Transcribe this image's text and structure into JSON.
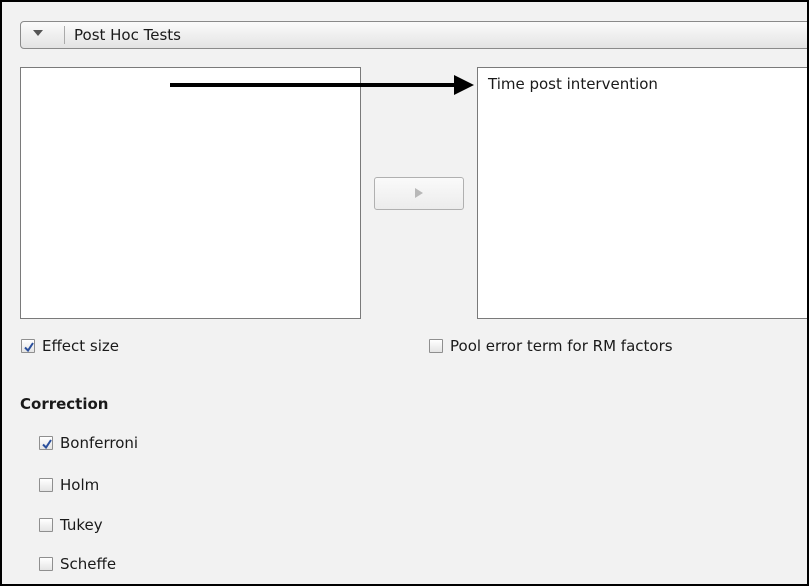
{
  "section": {
    "title": "Post Hoc Tests"
  },
  "lists": {
    "target_items": [
      "Time post intervention"
    ]
  },
  "options": {
    "effect_size": {
      "label": "Effect size",
      "checked": true
    },
    "pool_error": {
      "label": "Pool error term for RM factors",
      "checked": false
    }
  },
  "correction": {
    "heading": "Correction",
    "items": [
      {
        "label": "Bonferroni",
        "checked": true
      },
      {
        "label": "Holm",
        "checked": false
      },
      {
        "label": "Tukey",
        "checked": false
      },
      {
        "label": "Scheffe",
        "checked": false
      }
    ]
  },
  "colors": {
    "checkmark": "#2a4f9c",
    "annotation_arrow": "#000000",
    "panel_background": "#f2f2f2"
  },
  "icons": {
    "collapse": "triangle-down-icon",
    "move": "play-arrow-icon",
    "annotation": "arrow-right-icon"
  }
}
